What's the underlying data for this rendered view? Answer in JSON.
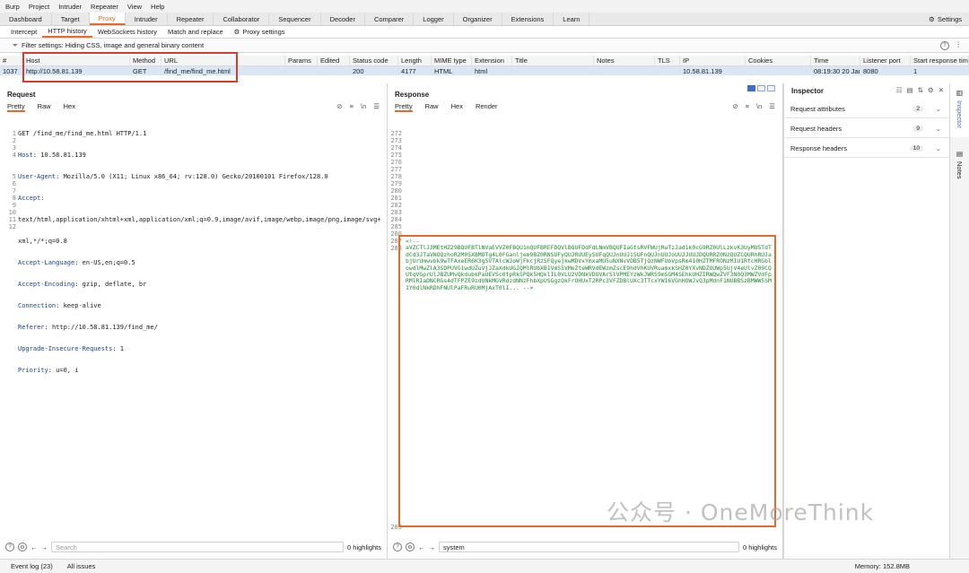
{
  "menu": [
    "Burp",
    "Project",
    "Intruder",
    "Repeater",
    "View",
    "Help"
  ],
  "main_tabs": [
    {
      "label": "Dashboard",
      "active": false
    },
    {
      "label": "Target",
      "active": false
    },
    {
      "label": "Proxy",
      "active": true
    },
    {
      "label": "Intruder",
      "active": false
    },
    {
      "label": "Repeater",
      "active": false
    },
    {
      "label": "Collaborator",
      "active": false
    },
    {
      "label": "Sequencer",
      "active": false
    },
    {
      "label": "Decoder",
      "active": false
    },
    {
      "label": "Comparer",
      "active": false
    },
    {
      "label": "Logger",
      "active": false
    },
    {
      "label": "Organizer",
      "active": false
    },
    {
      "label": "Extensions",
      "active": false
    },
    {
      "label": "Learn",
      "active": false
    }
  ],
  "settings_label": "Settings",
  "sub_tabs": [
    {
      "label": "Intercept",
      "active": false
    },
    {
      "label": "HTTP history",
      "active": true
    },
    {
      "label": "WebSockets history",
      "active": false
    },
    {
      "label": "Match and replace",
      "active": false
    },
    {
      "label": "Proxy settings",
      "active": false
    }
  ],
  "filter_text": "Filter settings: Hiding CSS, image and general binary content",
  "table": {
    "headers": [
      "#",
      "Host",
      "Method",
      "URL",
      "Params",
      "Edited",
      "Status code",
      "Length",
      "MIME type",
      "Extension",
      "Title",
      "Notes",
      "TLS",
      "IP",
      "Cookies",
      "Time",
      "Listener port",
      "Start response tim"
    ],
    "row": [
      "1037",
      "http://10.58.81.139",
      "GET",
      "/find_me/find_me.html",
      "",
      "",
      "200",
      "4177",
      "HTML",
      "html",
      "",
      "",
      "",
      "10.58.81.139",
      "",
      "08:19:30 20 Jan...",
      "8080",
      "1"
    ]
  },
  "request": {
    "title": "Request",
    "tabs": [
      "Pretty",
      "Raw",
      "Hex"
    ],
    "line1": "GET /find_me/find_me.html HTTP/1.1",
    "headers": [
      [
        "Host",
        "10.58.81.139"
      ],
      [
        "User-Agent",
        "Mozilla/5.0 (X11; Linux x86_64; rv:128.0) Gecko/20100101 Firefox/128.0"
      ],
      [
        "Accept",
        ""
      ],
      [
        "",
        "text/html,application/xhtml+xml,application/xml;q=0.9,image/avif,image/webp,image/png,image/svg+"
      ],
      [
        "",
        "xml,*/*;q=0.8"
      ],
      [
        "Accept-Language",
        "en-US,en;q=0.5"
      ],
      [
        "Accept-Encoding",
        "gzip, deflate, br"
      ],
      [
        "Connection",
        "keep-alive"
      ],
      [
        "Referer",
        "http://10.58.81.139/find_me/"
      ],
      [
        "Upgrade-Insecure-Requests",
        "1"
      ],
      [
        "Priority",
        "u=0, i"
      ]
    ],
    "line_numbers": [
      "1",
      "2",
      "3",
      "4",
      "",
      "",
      "5",
      "6",
      "7",
      "8",
      "9",
      "10",
      "11",
      "12"
    ],
    "search_placeholder": "Search",
    "highlights": "0 highlights"
  },
  "response": {
    "title": "Response",
    "tabs": [
      "Pretty",
      "Raw",
      "Hex",
      "Render"
    ],
    "line_numbers": [
      "272",
      "273",
      "274",
      "275",
      "276",
      "277",
      "278",
      "279",
      "280",
      "281",
      "282",
      "283",
      "284",
      "285",
      "286",
      "287",
      "288"
    ],
    "last_line": "289",
    "comment_open": "<!--",
    "encoded": "aVZCTlJ3MEtHZ29BQUFBTlNVaEVVZ0FBQU1nQUFBREFDQVlBQUFDdFdLNmVBQUFIaGtsRVFWUjRuTzJad1k0cG9RZ0UlLzkvK3UyMU5TdTdCd3JTaVNOQzhoR2M0SXBMOTg4L0FGanljem9BZ0RNSUFyQUJRUUEySUFqQUJnUUJiSUFnQUJnUUJoUUJJUUJDQURRZ0NzQUZCQURhRUJabjUrUmwvbk9wTFAxeER6K3g5VTAlcWJoWjFkcjRzSFQyejkwMDVxYmxaMU5uNXNvVDB5TjQzNWFUbVpsRm410HZTMFRONzM1U1RtcHRGblowdlMwZlA3SDPUVG1wdUZuVjJZaXdkUGJQMlRUbXB1VmS5VMeZteWRVdEWzmZscE9hdVhKUVRuamxkSHZ0YXvNDZOUWp5UjV4eUlvZ09CQUtqVGprUlJBZUMvQkdubkPaUEVSc0tpRk5PQk5HQklIL0VLU2VDNkVDUVArSlVPMEYzWkJWRS9mSGM4SEhkUHZIRWQwZVF3N0Q3MWZVdFpRMlRIaDNCRGs4dTFPZE9zdUNkMGVRdzdNNzFhbXpUSGgzQkFrOHUxT2RPc3VFZDBlUXc3TTcxYW16VGhHOWJvQ3pMdnF1NUBBSzBMWW5SM1Y0dlNkRDhFNUlPaFRuRU0MjAxT0lI...",
    "comment_close": "-->",
    "search_text": "system",
    "highlights": "0 highlights"
  },
  "inspector": {
    "title": "Inspector",
    "rows": [
      {
        "label": "Request attributes",
        "count": "2"
      },
      {
        "label": "Request headers",
        "count": "9"
      },
      {
        "label": "Response headers",
        "count": "10"
      }
    ]
  },
  "side_tabs": [
    "Inspector",
    "Notes"
  ],
  "status": {
    "event_log": "Event log (23)",
    "all_issues": "All issues",
    "memory": "Memory: 152.8MB"
  },
  "watermark": "公众号 · OneMoreThink"
}
